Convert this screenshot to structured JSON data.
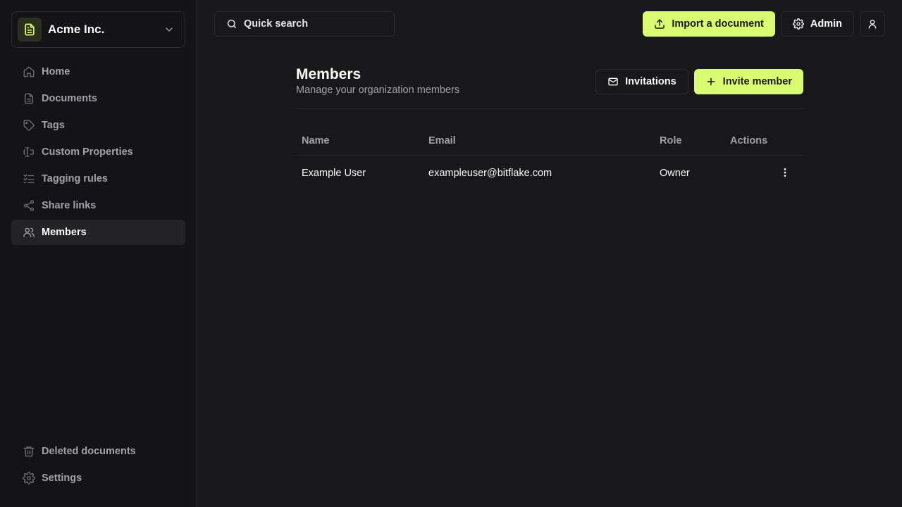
{
  "org": {
    "name": "Acme Inc."
  },
  "sidebar": {
    "items": [
      {
        "label": "Home",
        "icon": "home-icon"
      },
      {
        "label": "Documents",
        "icon": "document-icon"
      },
      {
        "label": "Tags",
        "icon": "tag-icon"
      },
      {
        "label": "Custom Properties",
        "icon": "custom-properties-icon"
      },
      {
        "label": "Tagging rules",
        "icon": "list-checks-icon"
      },
      {
        "label": "Share links",
        "icon": "share-icon"
      },
      {
        "label": "Members",
        "icon": "users-icon",
        "active": true
      }
    ],
    "bottom": [
      {
        "label": "Deleted documents",
        "icon": "trash-icon"
      },
      {
        "label": "Settings",
        "icon": "gear-icon"
      }
    ]
  },
  "topbar": {
    "search_label": "Quick search",
    "import_label": "Import a document",
    "admin_label": "Admin"
  },
  "page": {
    "title": "Members",
    "subtitle": "Manage your organization members",
    "invitations_label": "Invitations",
    "invite_label": "Invite member"
  },
  "table": {
    "headers": [
      "Name",
      "Email",
      "Role",
      "Actions"
    ],
    "rows": [
      {
        "name": "Example User",
        "email": "exampleuser@bitflake.com",
        "role": "Owner"
      }
    ]
  },
  "colors": {
    "accent": "#d9fb6f",
    "background": "#18181b",
    "sidebar": "#141416"
  }
}
